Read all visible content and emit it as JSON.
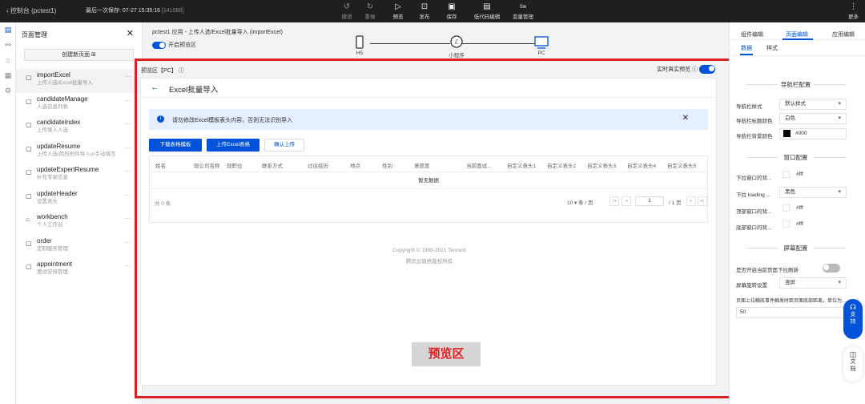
{
  "topbar": {
    "back_label": "控制台 (pctest1)",
    "last_save_prefix": "最后一次保存: 07-27 15:35:16",
    "last_save_id": "[141068]",
    "buttons": [
      {
        "icon": "undo-icon",
        "label": "撤销",
        "disabled": true
      },
      {
        "icon": "redo-icon",
        "label": "重做",
        "disabled": true
      },
      {
        "icon": "play-icon",
        "label": "预览",
        "disabled": false
      },
      {
        "icon": "publish-icon",
        "label": "发布",
        "disabled": false
      },
      {
        "icon": "save-icon",
        "label": "保存",
        "disabled": false
      },
      {
        "icon": "lowcode-icon",
        "label": "低代码编辑",
        "disabled": false
      },
      {
        "icon": "variable-icon",
        "label": "变量管理",
        "disabled": false
      }
    ],
    "more_label": "更多",
    "variable_icon_text": "Sw"
  },
  "left_rail_icons": [
    "pages-icon",
    "flow-icon",
    "component-icon",
    "data-icon",
    "settings-icon"
  ],
  "sidebar": {
    "title": "页面管理",
    "new_page_label": "创建新页面 ⊞",
    "pages": [
      {
        "name": "importExcel",
        "desc": "上传人选/Excel批量导入",
        "active": true,
        "icon": "page-icon"
      },
      {
        "name": "candidateManage",
        "desc": "人选信息列表",
        "active": false,
        "icon": "page-icon"
      },
      {
        "name": "candidateIndex",
        "desc": "上传录入人选",
        "active": false,
        "icon": "page-icon"
      },
      {
        "name": "updateResume",
        "desc": "上传人选/简历附件导入or手动填写",
        "active": false,
        "icon": "page-icon"
      },
      {
        "name": "updateExpertResume",
        "desc": "补充专家信息",
        "active": false,
        "icon": "page-icon"
      },
      {
        "name": "updateHeader",
        "desc": "设置表头",
        "active": false,
        "icon": "page-icon"
      },
      {
        "name": "workbench",
        "desc": "个人工作台",
        "active": false,
        "icon": "home-icon"
      },
      {
        "name": "order",
        "desc": "定制服务管理",
        "active": false,
        "icon": "page-icon"
      },
      {
        "name": "appointment",
        "desc": "面试安排管理",
        "active": false,
        "icon": "page-icon"
      }
    ]
  },
  "canvas": {
    "breadcrumb": "pctest1 应用 - 上传人选/Excel批量导入 (importExcel)",
    "preview_toggle_label": "开启预览区",
    "devices": [
      {
        "label": "H5",
        "icon": "mobile-icon"
      },
      {
        "label": "小程序",
        "icon": "miniprogram-icon"
      },
      {
        "label": "PC",
        "icon": "monitor-icon",
        "active": true
      }
    ],
    "preview_area_label": "预览区【PC】",
    "realtime_preview_label": "实时真实预览",
    "watermark_label": "预览区"
  },
  "preview_page": {
    "title": "Excel批量导入",
    "alert_text": "请勿修改Excel模板表头内容，否则无法识别导入",
    "buttons": {
      "download": "下载表格模板",
      "upload": "上传Excel表格",
      "confirm": "确认上传"
    },
    "table_columns": [
      "姓名",
      "现公司名称",
      "现职位",
      "联系方式",
      "过往经历",
      "地点",
      "性别",
      "意愿度",
      "当前面试...",
      "自定义表头1",
      "自定义表头2",
      "自定义表头3",
      "自定义表头4",
      "自定义表头5"
    ],
    "no_data": "暂无数据",
    "total": "共 0 条",
    "page_size": "10 ▾ 条 / 页",
    "page_nav": [
      "|◂",
      "◂",
      "▸",
      "▸|"
    ],
    "page_input": "1",
    "page_count": "/ 1 页",
    "copyright": "Copyright © 1998-2021 Tencent",
    "copyright2": "腾讯云微搭版权所有"
  },
  "right_panel": {
    "tabs": [
      {
        "label": "组件编辑",
        "active": false
      },
      {
        "label": "页面编辑",
        "active": true
      },
      {
        "label": "应用编辑",
        "active": false
      }
    ],
    "subtabs": [
      {
        "label": "数据",
        "active": true
      },
      {
        "label": "样式",
        "active": false
      }
    ],
    "nav_section": "导航栏配置",
    "nav_rows": [
      {
        "label": "导航栏样式",
        "value": "默认样式"
      },
      {
        "label": "导航栏标题颜色",
        "value": "白色"
      },
      {
        "label": "导航栏背景颜色",
        "value": "#000",
        "color": "#000000"
      }
    ],
    "window_section": "窗口配置",
    "window_rows": [
      {
        "label": "下拉窗口的背...",
        "value": "#fff"
      },
      {
        "label": "下拉 loading ...",
        "value": "黑色"
      },
      {
        "label": "顶部窗口的背...",
        "value": "#fff"
      },
      {
        "label": "底部窗口的背...",
        "value": "#fff"
      }
    ],
    "screen_section": "屏幕配置",
    "pull_refresh_label": "是否开启当前页面下拉刷新",
    "rotation_label": "屏幕旋转设置",
    "rotation_value": "竖屏",
    "reach_bottom_label": "页面上拉触底事件触发时距页面底部距离，单位为...",
    "reach_bottom_value": "50"
  },
  "floating": {
    "support_label": "支持",
    "docs_label": "文档"
  },
  "colors": {
    "accent": "#0052d9",
    "frame": "#e02020",
    "topbar": "#1f1f1f"
  }
}
